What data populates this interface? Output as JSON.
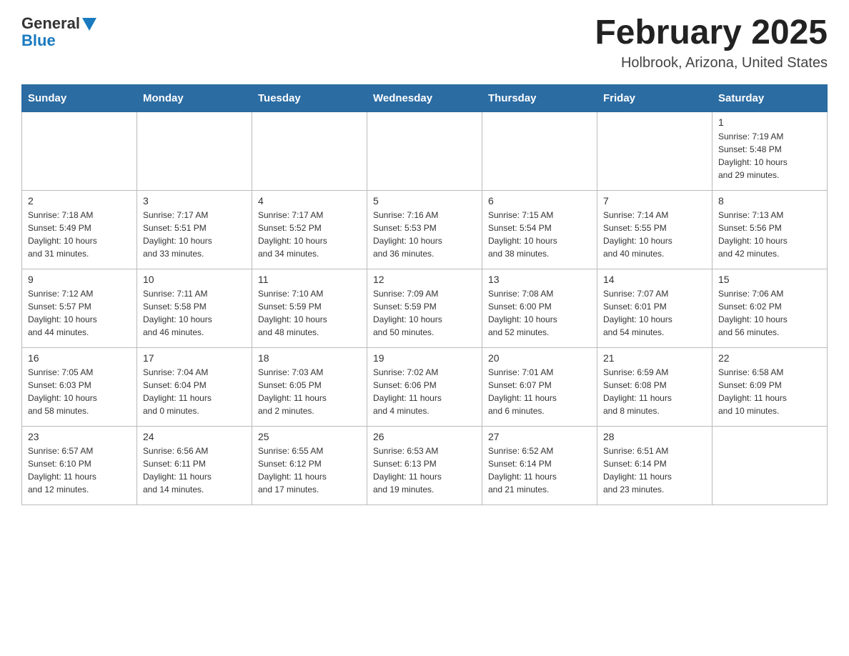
{
  "header": {
    "logo_general": "General",
    "logo_blue": "Blue",
    "title": "February 2025",
    "location": "Holbrook, Arizona, United States"
  },
  "days_of_week": [
    "Sunday",
    "Monday",
    "Tuesday",
    "Wednesday",
    "Thursday",
    "Friday",
    "Saturday"
  ],
  "weeks": [
    [
      {
        "num": "",
        "info": ""
      },
      {
        "num": "",
        "info": ""
      },
      {
        "num": "",
        "info": ""
      },
      {
        "num": "",
        "info": ""
      },
      {
        "num": "",
        "info": ""
      },
      {
        "num": "",
        "info": ""
      },
      {
        "num": "1",
        "info": "Sunrise: 7:19 AM\nSunset: 5:48 PM\nDaylight: 10 hours\nand 29 minutes."
      }
    ],
    [
      {
        "num": "2",
        "info": "Sunrise: 7:18 AM\nSunset: 5:49 PM\nDaylight: 10 hours\nand 31 minutes."
      },
      {
        "num": "3",
        "info": "Sunrise: 7:17 AM\nSunset: 5:51 PM\nDaylight: 10 hours\nand 33 minutes."
      },
      {
        "num": "4",
        "info": "Sunrise: 7:17 AM\nSunset: 5:52 PM\nDaylight: 10 hours\nand 34 minutes."
      },
      {
        "num": "5",
        "info": "Sunrise: 7:16 AM\nSunset: 5:53 PM\nDaylight: 10 hours\nand 36 minutes."
      },
      {
        "num": "6",
        "info": "Sunrise: 7:15 AM\nSunset: 5:54 PM\nDaylight: 10 hours\nand 38 minutes."
      },
      {
        "num": "7",
        "info": "Sunrise: 7:14 AM\nSunset: 5:55 PM\nDaylight: 10 hours\nand 40 minutes."
      },
      {
        "num": "8",
        "info": "Sunrise: 7:13 AM\nSunset: 5:56 PM\nDaylight: 10 hours\nand 42 minutes."
      }
    ],
    [
      {
        "num": "9",
        "info": "Sunrise: 7:12 AM\nSunset: 5:57 PM\nDaylight: 10 hours\nand 44 minutes."
      },
      {
        "num": "10",
        "info": "Sunrise: 7:11 AM\nSunset: 5:58 PM\nDaylight: 10 hours\nand 46 minutes."
      },
      {
        "num": "11",
        "info": "Sunrise: 7:10 AM\nSunset: 5:59 PM\nDaylight: 10 hours\nand 48 minutes."
      },
      {
        "num": "12",
        "info": "Sunrise: 7:09 AM\nSunset: 5:59 PM\nDaylight: 10 hours\nand 50 minutes."
      },
      {
        "num": "13",
        "info": "Sunrise: 7:08 AM\nSunset: 6:00 PM\nDaylight: 10 hours\nand 52 minutes."
      },
      {
        "num": "14",
        "info": "Sunrise: 7:07 AM\nSunset: 6:01 PM\nDaylight: 10 hours\nand 54 minutes."
      },
      {
        "num": "15",
        "info": "Sunrise: 7:06 AM\nSunset: 6:02 PM\nDaylight: 10 hours\nand 56 minutes."
      }
    ],
    [
      {
        "num": "16",
        "info": "Sunrise: 7:05 AM\nSunset: 6:03 PM\nDaylight: 10 hours\nand 58 minutes."
      },
      {
        "num": "17",
        "info": "Sunrise: 7:04 AM\nSunset: 6:04 PM\nDaylight: 11 hours\nand 0 minutes."
      },
      {
        "num": "18",
        "info": "Sunrise: 7:03 AM\nSunset: 6:05 PM\nDaylight: 11 hours\nand 2 minutes."
      },
      {
        "num": "19",
        "info": "Sunrise: 7:02 AM\nSunset: 6:06 PM\nDaylight: 11 hours\nand 4 minutes."
      },
      {
        "num": "20",
        "info": "Sunrise: 7:01 AM\nSunset: 6:07 PM\nDaylight: 11 hours\nand 6 minutes."
      },
      {
        "num": "21",
        "info": "Sunrise: 6:59 AM\nSunset: 6:08 PM\nDaylight: 11 hours\nand 8 minutes."
      },
      {
        "num": "22",
        "info": "Sunrise: 6:58 AM\nSunset: 6:09 PM\nDaylight: 11 hours\nand 10 minutes."
      }
    ],
    [
      {
        "num": "23",
        "info": "Sunrise: 6:57 AM\nSunset: 6:10 PM\nDaylight: 11 hours\nand 12 minutes."
      },
      {
        "num": "24",
        "info": "Sunrise: 6:56 AM\nSunset: 6:11 PM\nDaylight: 11 hours\nand 14 minutes."
      },
      {
        "num": "25",
        "info": "Sunrise: 6:55 AM\nSunset: 6:12 PM\nDaylight: 11 hours\nand 17 minutes."
      },
      {
        "num": "26",
        "info": "Sunrise: 6:53 AM\nSunset: 6:13 PM\nDaylight: 11 hours\nand 19 minutes."
      },
      {
        "num": "27",
        "info": "Sunrise: 6:52 AM\nSunset: 6:14 PM\nDaylight: 11 hours\nand 21 minutes."
      },
      {
        "num": "28",
        "info": "Sunrise: 6:51 AM\nSunset: 6:14 PM\nDaylight: 11 hours\nand 23 minutes."
      },
      {
        "num": "",
        "info": ""
      }
    ]
  ]
}
